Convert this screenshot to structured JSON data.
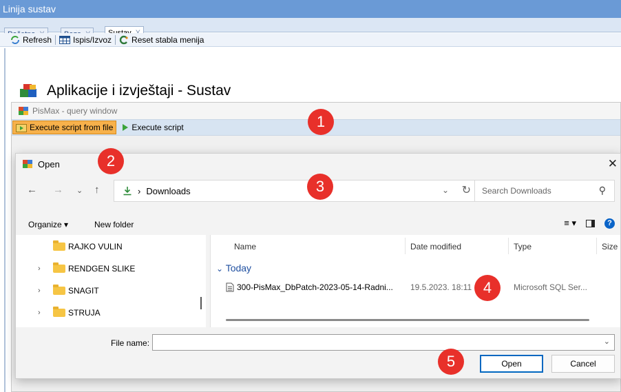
{
  "app": {
    "title": "Linija sustav"
  },
  "tabs": [
    {
      "label": "Početna"
    },
    {
      "label": "Baza"
    },
    {
      "label": "Sustav"
    }
  ],
  "toolbar": {
    "refresh": "Refresh",
    "ispis": "Ispis/Izvoz",
    "reset": "Reset stabla menija"
  },
  "page": {
    "heading": "Aplikacije i izvještaji - Sustav"
  },
  "query_window": {
    "title": "PisMax - query window",
    "exec_file": "Execute script from file",
    "exec": "Execute script"
  },
  "dialog": {
    "title": "Open",
    "address": "Downloads",
    "search_placeholder": "Search Downloads",
    "organize": "Organize",
    "new_folder": "New folder",
    "nav_items": [
      {
        "label": "RAJKO VULIN"
      },
      {
        "label": "RENDGEN SLIKE"
      },
      {
        "label": "SNAGIT"
      },
      {
        "label": "STRUJA"
      }
    ],
    "columns": {
      "name": "Name",
      "date": "Date modified",
      "type": "Type",
      "size": "Size"
    },
    "group": "Today",
    "file": {
      "name": "300-PisMax_DbPatch-2023-05-14-Radni...",
      "date": "19.5.2023. 18:11",
      "type": "Microsoft SQL Ser..."
    },
    "file_name_label": "File name:",
    "file_name_value": "",
    "open_button": "Open",
    "cancel_button": "Cancel"
  },
  "badges": [
    "1",
    "2",
    "3",
    "4",
    "5"
  ],
  "colors": {
    "accent": "#6a9ad6",
    "badge": "#e8302a",
    "highlight": "#f7b14b",
    "primary_button_border": "#0067c0"
  }
}
